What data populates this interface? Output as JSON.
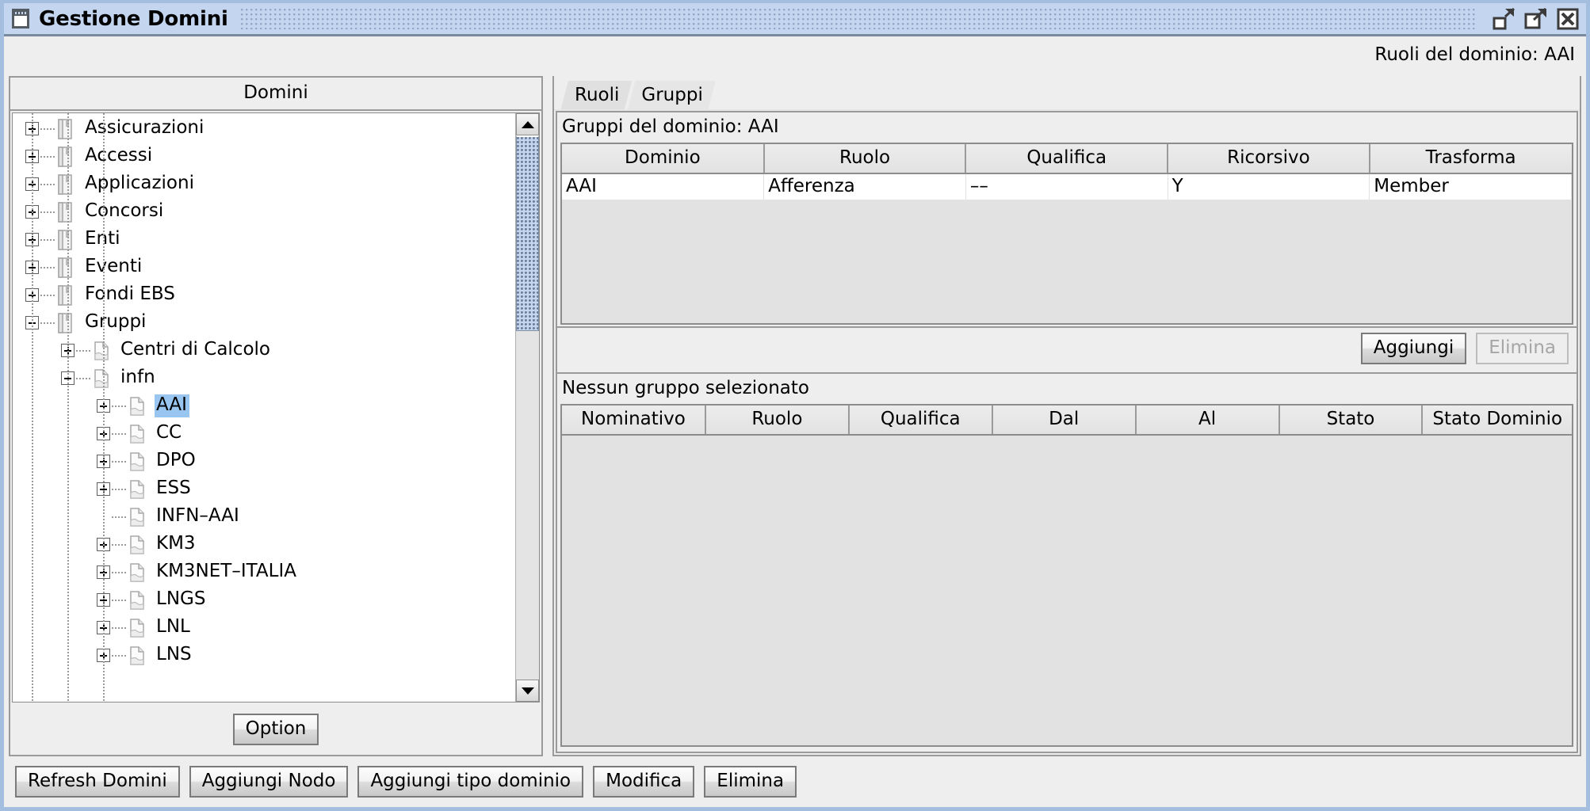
{
  "window": {
    "title": "Gestione Domini",
    "icon": "window-icon",
    "controls": [
      {
        "name": "minimize-button",
        "icon": "minimize-icon"
      },
      {
        "name": "maximize-button",
        "icon": "maximize-icon"
      },
      {
        "name": "close-button",
        "icon": "close-icon"
      }
    ]
  },
  "header": {
    "domain_roles_label": "Ruoli del dominio: AAI"
  },
  "left_panel": {
    "title": "Domini",
    "option_button": "Option",
    "tree": [
      {
        "label": "Assicurazioni",
        "depth": 0,
        "expander": "plus",
        "icon": "binder-icon",
        "selected": false
      },
      {
        "label": "Accessi",
        "depth": 0,
        "expander": "plus",
        "icon": "binder-icon",
        "selected": false
      },
      {
        "label": "Applicazioni",
        "depth": 0,
        "expander": "plus",
        "icon": "binder-icon",
        "selected": false
      },
      {
        "label": "Concorsi",
        "depth": 0,
        "expander": "plus",
        "icon": "binder-icon",
        "selected": false
      },
      {
        "label": "Enti",
        "depth": 0,
        "expander": "plus",
        "icon": "binder-icon",
        "selected": false
      },
      {
        "label": "Eventi",
        "depth": 0,
        "expander": "plus",
        "icon": "binder-icon",
        "selected": false
      },
      {
        "label": "Fondi EBS",
        "depth": 0,
        "expander": "plus",
        "icon": "binder-icon",
        "selected": false
      },
      {
        "label": "Gruppi",
        "depth": 0,
        "expander": "minus",
        "icon": "binder-icon",
        "selected": false
      },
      {
        "label": "Centri di Calcolo",
        "depth": 1,
        "expander": "plus",
        "icon": "document-icon",
        "selected": false
      },
      {
        "label": "infn",
        "depth": 1,
        "expander": "minus",
        "icon": "document-icon",
        "selected": false
      },
      {
        "label": "AAI",
        "depth": 2,
        "expander": "plus",
        "icon": "document-icon",
        "selected": true
      },
      {
        "label": "CC",
        "depth": 2,
        "expander": "plus",
        "icon": "document-icon",
        "selected": false
      },
      {
        "label": "DPO",
        "depth": 2,
        "expander": "plus",
        "icon": "document-icon",
        "selected": false
      },
      {
        "label": "ESS",
        "depth": 2,
        "expander": "plus",
        "icon": "document-icon",
        "selected": false
      },
      {
        "label": "INFN–AAI",
        "depth": 2,
        "expander": "none",
        "icon": "document-icon",
        "selected": false
      },
      {
        "label": "KM3",
        "depth": 2,
        "expander": "plus",
        "icon": "document-icon",
        "selected": false
      },
      {
        "label": "KM3NET–ITALIA",
        "depth": 2,
        "expander": "plus",
        "icon": "document-icon",
        "selected": false
      },
      {
        "label": "LNGS",
        "depth": 2,
        "expander": "plus",
        "icon": "document-icon",
        "selected": false
      },
      {
        "label": "LNL",
        "depth": 2,
        "expander": "plus",
        "icon": "document-icon",
        "selected": false
      },
      {
        "label": "LNS",
        "depth": 2,
        "expander": "plus",
        "icon": "document-icon",
        "selected": false
      }
    ]
  },
  "right_panel": {
    "tabs": [
      {
        "label": "Ruoli",
        "active": false
      },
      {
        "label": "Gruppi",
        "active": true
      }
    ],
    "groups_section": {
      "title": "Gruppi del dominio: AAI",
      "columns": [
        "Dominio",
        "Ruolo",
        "Qualifica",
        "Ricorsivo",
        "Trasforma"
      ],
      "rows": [
        [
          "AAI",
          "Afferenza",
          "––",
          "Y",
          "Member"
        ]
      ],
      "buttons": [
        {
          "label": "Aggiungi",
          "enabled": true
        },
        {
          "label": "Elimina",
          "enabled": false
        }
      ]
    },
    "members_section": {
      "title": "Nessun gruppo selezionato",
      "columns": [
        "Nominativo",
        "Ruolo",
        "Qualifica",
        "Dal",
        "Al",
        "Stato",
        "Stato Dominio"
      ],
      "rows": []
    }
  },
  "bottom_bar": {
    "buttons": [
      {
        "label": "Refresh Domini",
        "enabled": true
      },
      {
        "label": "Aggiungi Nodo",
        "enabled": true
      },
      {
        "label": "Aggiungi tipo dominio",
        "enabled": true
      },
      {
        "label": "Modifica",
        "enabled": true
      },
      {
        "label": "Elimina",
        "enabled": true
      }
    ]
  },
  "colors": {
    "titlebar": "#c3d5ef",
    "window_border": "#a3bede",
    "panel_bg": "#eeeeee",
    "selection": "#99c6f0",
    "grid_header": "#e6e6e6",
    "disabled_text": "#a6a6a6"
  }
}
